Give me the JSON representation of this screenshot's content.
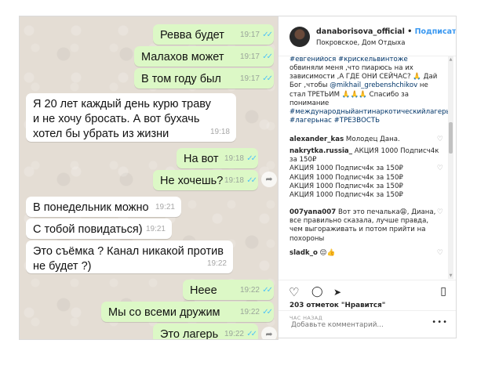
{
  "chat": {
    "messages": [
      {
        "dir": "out",
        "text": "Ревва будет",
        "time": "19:17",
        "ticks": "✓✓"
      },
      {
        "dir": "out",
        "text": "Малахов может",
        "time": "19:17",
        "ticks": "✓✓"
      },
      {
        "dir": "out",
        "text": "В том году был",
        "time": "19:17",
        "ticks": "✓✓"
      },
      {
        "dir": "in",
        "text": "Я 20 лет каждый день курю траву и не хочу бросать. А вот бухачь хотел бы убрать из жизни",
        "time": "19:18"
      },
      {
        "dir": "out",
        "text": "На вот",
        "time": "19:18",
        "ticks": "✓✓"
      },
      {
        "dir": "out",
        "text": "Не хочешь?",
        "time": "19:18",
        "ticks": "✓✓"
      },
      {
        "dir": "in",
        "text": "В понедельник можно",
        "time": "19:21"
      },
      {
        "dir": "in",
        "text": "С тобой повидаться)",
        "time": "19:21"
      },
      {
        "dir": "in",
        "text": "Это съёмка ? Канал никакой против не будет ?)",
        "time": "19:22"
      },
      {
        "dir": "out",
        "text": "Нееe",
        "time": "19:22",
        "ticks": "✓✓"
      },
      {
        "dir": "out",
        "text": "Мы со всеми дружим",
        "time": "19:22",
        "ticks": "✓✓"
      },
      {
        "dir": "out",
        "text": "Это лагерь",
        "time": "19:22",
        "ticks": "✓✓"
      }
    ],
    "forward_icon": "share-arrow"
  },
  "post": {
    "username": "danaborisova_official",
    "separator": "•",
    "follow_label": "Подписаться",
    "location": "Покровское, Дом Отдыха",
    "caption_top": "#евгенийося #крискельвинтоже",
    "caption": "обвиняли меня ,что пиарюсь на их зависимости ,А ГДЕ ОНИ СЕЙЧАС? 🙏 Дай Бог ,чтобы",
    "caption_mention": "@mikhail_grebenshchikov",
    "caption_rest": "не стал ТРЕТЬИМ 🙏🙏🙏 Спасибо за понимание",
    "caption_tags": "#международныйантинаркотическийлагерь #лагерьнас #ТРЕЗВОСТЬ",
    "comments": [
      {
        "user": "alexander_kas",
        "text": "Молодец Дана."
      },
      {
        "user": "nakrytka.russia_",
        "text": "АКЦИЯ 1000 Подписч4к за 150₽",
        "extra": [
          "АКЦИЯ 1000 Подписч4к за 150₽",
          "АКЦИЯ 1000 Подписч4к за 150₽",
          "АКЦИЯ 1000 Подписч4к за 150₽",
          "АКЦИЯ 1000 Подписч4к за 150₽"
        ]
      },
      {
        "user": "007yana007",
        "text": "Вот это печалька😩, Диана, все правильно сказала, лучше правда, чем выгораживать и потом прийти на похороны"
      },
      {
        "user": "sladk_o",
        "text": "😔👍"
      }
    ],
    "likes": "203 отметок \"Нравится\"",
    "time_ago": "ЧАС НАЗАД",
    "add_comment_placeholder": "Добавьте комментарий...",
    "more_label": "•••"
  }
}
